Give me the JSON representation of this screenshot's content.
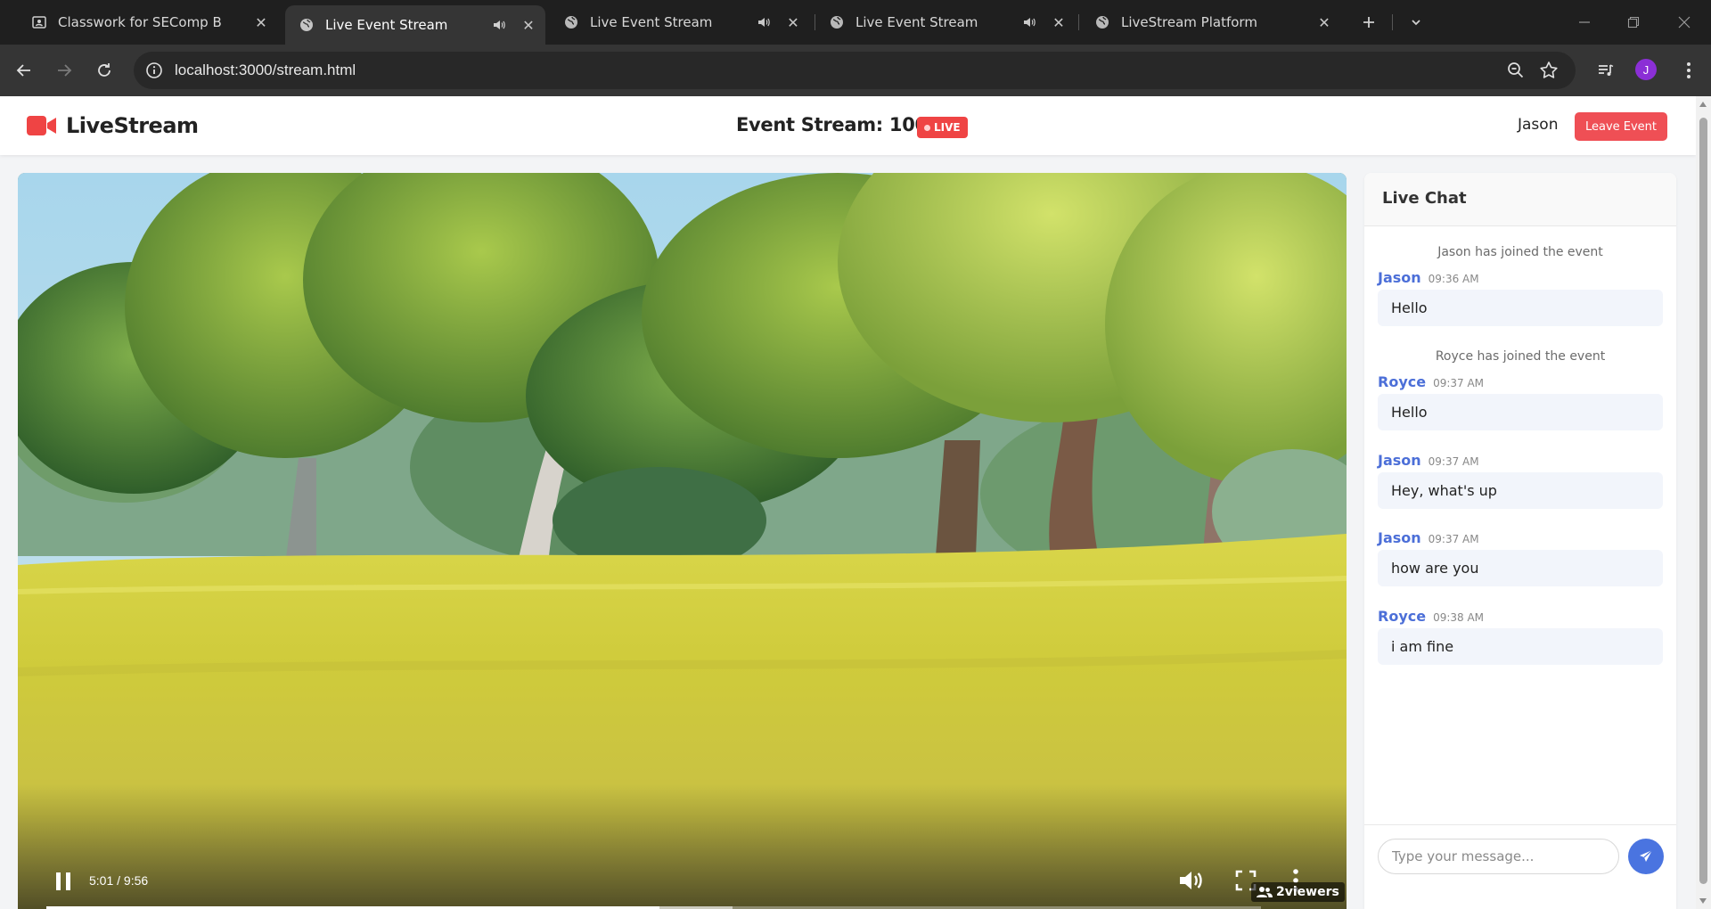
{
  "browser": {
    "tabs": [
      {
        "title": "Classwork for SEComp B",
        "icon": "classroom-icon",
        "audio": false,
        "active": false
      },
      {
        "title": "Live Event Stream",
        "icon": "globe-icon",
        "audio": true,
        "active": true
      },
      {
        "title": "Live Event Stream",
        "icon": "globe-icon",
        "audio": true,
        "active": false
      },
      {
        "title": "Live Event Stream",
        "icon": "globe-icon",
        "audio": true,
        "active": false
      },
      {
        "title": "LiveStream Platform",
        "icon": "globe-icon",
        "audio": false,
        "active": false
      }
    ],
    "url": "localhost:3000/stream.html",
    "profile_initial": "J"
  },
  "header": {
    "logo_text": "LiveStream",
    "event_title": "Event Stream: 100",
    "live_badge": "LIVE",
    "username": "Jason",
    "leave_button": "Leave Event"
  },
  "player": {
    "time": "5:01 / 9:56",
    "played_fraction": 0.505,
    "buffered_fraction": 0.565,
    "viewers": "2viewers",
    "state": "playing"
  },
  "chat": {
    "title": "Live Chat",
    "messages": [
      {
        "type": "system",
        "text": "Jason has joined the event"
      },
      {
        "type": "message",
        "user": "Jason",
        "time": "09:36 AM",
        "text": "Hello"
      },
      {
        "type": "system",
        "text": "Royce has joined the event"
      },
      {
        "type": "message",
        "user": "Royce",
        "time": "09:37 AM",
        "text": "Hello"
      },
      {
        "type": "message",
        "user": "Jason",
        "time": "09:37 AM",
        "text": "Hey, what's up"
      },
      {
        "type": "message",
        "user": "Jason",
        "time": "09:37 AM",
        "text": "how are you"
      },
      {
        "type": "message",
        "user": "Royce",
        "time": "09:38 AM",
        "text": "i am fine"
      }
    ],
    "input_placeholder": "Type your message..."
  },
  "colors": {
    "accent": "#ef4444",
    "chat_user": "#4c6fd8",
    "send_button": "#4a74e0"
  }
}
